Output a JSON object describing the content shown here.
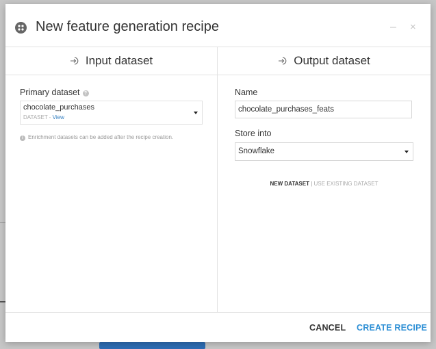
{
  "modal": {
    "title": "New feature generation recipe",
    "minimize_label": "–",
    "close_label": "×"
  },
  "input": {
    "header": "Input dataset",
    "primary_label": "Primary dataset",
    "help_symbol": "?",
    "dataset_name": "chocolate_purchases",
    "dataset_type": "DATASET",
    "separator": " - ",
    "view_label": "View",
    "info_symbol": "i",
    "enrichment_note": "Enrichment datasets can be added after the recipe creation."
  },
  "output": {
    "header": "Output dataset",
    "name_label": "Name",
    "name_value": "chocolate_purchases_feats",
    "store_label": "Store into",
    "store_value": "Snowflake",
    "new_dataset_label": "NEW DATASET",
    "mode_separator": "|",
    "use_existing_label": "USE EXISTING DATASET"
  },
  "footer": {
    "cancel_label": "CANCEL",
    "create_label": "CREATE RECIPE"
  },
  "colors": {
    "accent": "#2d8fd5",
    "link": "#2d7bbf",
    "backdrop": "#c7c7c7"
  },
  "icons": {
    "title": "recipe-icon",
    "input_header": "sign-in-icon",
    "output_header": "sign-in-icon",
    "help": "question-icon",
    "info": "info-icon",
    "dropdown": "caret-down-icon"
  }
}
